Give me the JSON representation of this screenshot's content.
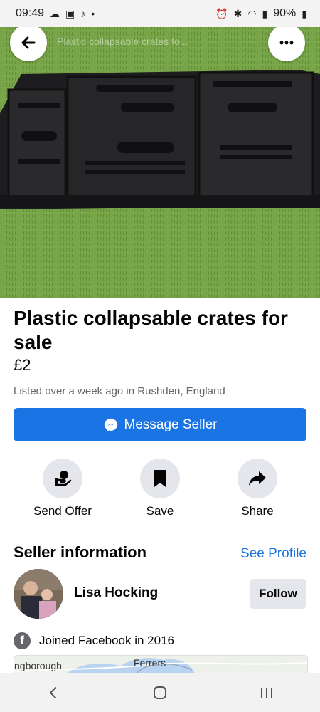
{
  "status_bar": {
    "time": "09:49",
    "battery": "90%",
    "icons_left": [
      "cloud-icon",
      "image-icon",
      "bell-icon",
      "dot-icon"
    ],
    "icons_right": [
      "alarm-icon",
      "bluetooth-icon",
      "wifi-icon",
      "signal-icon",
      "battery-icon"
    ]
  },
  "hero": {
    "url_text": "Plastic collapsable crates fo..."
  },
  "listing": {
    "title": "Plastic collapsable crates for sale",
    "price": "£2",
    "listed_text": "Listed over a week ago in Rushden, England"
  },
  "message_button": {
    "label": "Message Seller"
  },
  "actions": {
    "send_offer": "Send Offer",
    "save": "Save",
    "share": "Share"
  },
  "seller": {
    "section_title": "Seller information",
    "see_profile": "See Profile",
    "name": "Lisa Hocking",
    "follow": "Follow",
    "joined": "Joined Facebook in 2016"
  },
  "map": {
    "label_left": "ngborough",
    "label_center": "Ferrers"
  },
  "colors": {
    "accent": "#1b74e4",
    "secondary_bg": "#e4e6eb",
    "muted_text": "#65676b"
  }
}
